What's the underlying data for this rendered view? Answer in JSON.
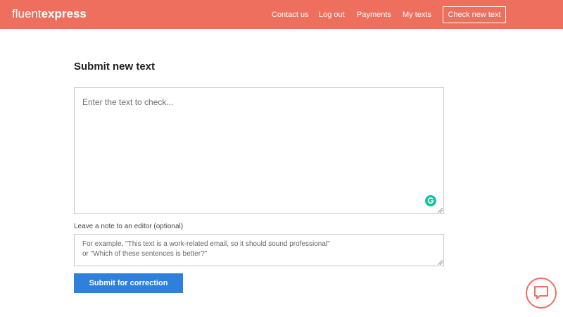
{
  "brand": {
    "logo_light": "fluent",
    "logo_bold": "express",
    "color": "#ef6f5f"
  },
  "nav": {
    "contact": "Contact us",
    "logout": "Log out",
    "payments": "Payments",
    "my_texts": "My texts",
    "check_new_text": "Check new text"
  },
  "main": {
    "title": "Submit new text",
    "text_input": {
      "placeholder": "Enter the text to check...",
      "value": ""
    },
    "note_label": "Leave a note to an editor (optional)",
    "note_input": {
      "placeholder": "For example, \"This text is a work-related email, so it should sound professional\"\nor \"Which of these sentences is better?\"",
      "value": ""
    },
    "submit_label": "Submit for correction"
  },
  "colors": {
    "accent": "#ef6f5f",
    "button": "#2f7fdc",
    "grammarly": "#15c39a"
  },
  "icons": {
    "chat": "chat-bubble-icon",
    "grammarly": "grammarly-icon"
  }
}
